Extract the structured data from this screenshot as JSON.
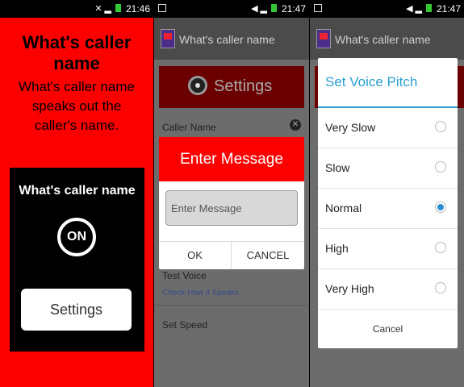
{
  "panel1": {
    "status_time": "21:46",
    "title": "What's caller name",
    "description": "What's caller name speaks out the caller's name.",
    "card_title": "What's caller name",
    "toggle_label": "ON",
    "settings_button": "Settings"
  },
  "panel2": {
    "status_time": "21:47",
    "app_title": "What's caller name",
    "settings_header": "Settings",
    "row_caller_name": "Caller Name",
    "row_test_voice": "Test Voice",
    "row_test_voice_sub": "Check How it Speaks",
    "row_set_speed": "Set Speed",
    "dialog": {
      "title": "Enter Message",
      "input_placeholder": "Enter Message",
      "ok_label": "OK",
      "cancel_label": "CANCEL"
    }
  },
  "panel3": {
    "status_time": "21:47",
    "app_title": "What's caller name",
    "dialog_title": "Set Voice Pitch",
    "options": [
      {
        "label": "Very Slow",
        "selected": false
      },
      {
        "label": "Slow",
        "selected": false
      },
      {
        "label": "Normal",
        "selected": true
      },
      {
        "label": "High",
        "selected": false
      },
      {
        "label": "Very High",
        "selected": false
      }
    ],
    "cancel_label": "Cancel"
  },
  "colors": {
    "primary_red": "#fc0000",
    "accent_blue": "#2aa0d0",
    "dim_gray": "#6c6c6c"
  }
}
